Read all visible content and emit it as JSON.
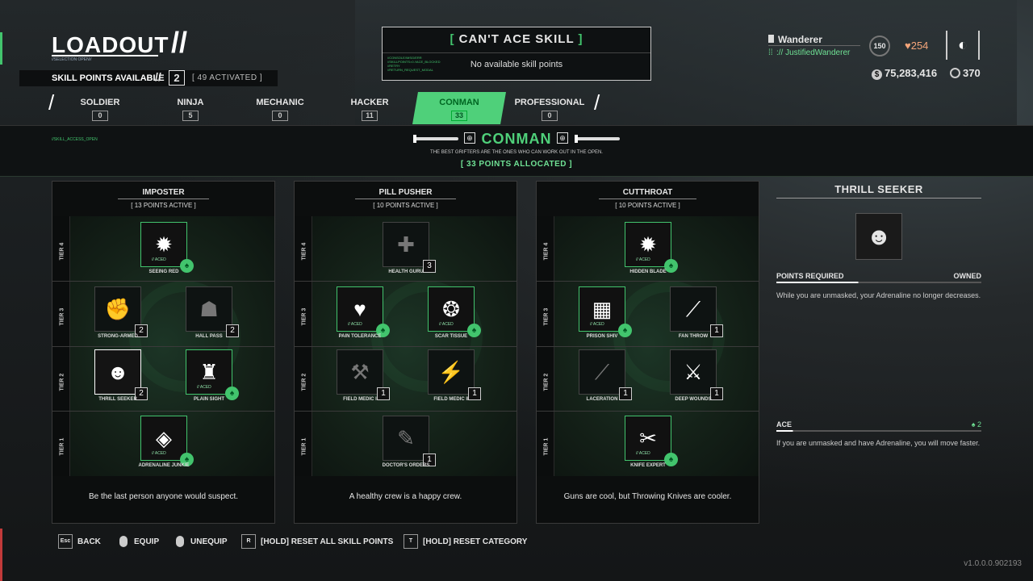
{
  "header": {
    "title": "LOADOUT",
    "sub_tag": "//SELECTION OPEN//",
    "skill_points_label": "SKILL POINTS AVAILABLE",
    "skill_points_value": "2",
    "activated_text": "[ 49 ACTIVATED ]"
  },
  "notice": {
    "title_open": "[",
    "title": "CAN'T ACE SKILL",
    "title_close": "]",
    "message": "No available skill points",
    "tiny": "//CONSOLE//MSG/ERR //SKILLPOINTS=0 //ACE_BLOCKED //RETRY //RETURN_REQUEST_MODAL"
  },
  "user": {
    "name": "Wanderer",
    "tag": ":// JustifiedWanderer",
    "level": "150",
    "hearts": "254",
    "cash": "75,283,416",
    "coins": "370"
  },
  "tabs": [
    {
      "label": "SOLDIER",
      "count": "0"
    },
    {
      "label": "NINJA",
      "count": "5"
    },
    {
      "label": "MECHANIC",
      "count": "0"
    },
    {
      "label": "HACKER",
      "count": "11"
    },
    {
      "label": "CONMAN",
      "count": "33"
    },
    {
      "label": "PROFESSIONAL",
      "count": "0"
    }
  ],
  "category": {
    "access": "//SKILL_ACCESS_OPEN",
    "name": "CONMAN",
    "desc": "THE BEST GRIFTERS ARE THE ONES WHO CAN WORK OUT IN THE OPEN.",
    "points": "[ 33 POINTS ALLOCATED ]"
  },
  "tiers": [
    "TIER 4",
    "TIER 3",
    "TIER 2",
    "TIER 1"
  ],
  "trees": [
    {
      "name": "IMPOSTER",
      "points": "[ 13 POINTS ACTIVE ]",
      "footer": "Be the last person anyone would suspect.",
      "skills": [
        {
          "label": "SEEING RED",
          "aced": "// ACED"
        },
        {
          "label": "STRONG-ARMED",
          "badge": "2"
        },
        {
          "label": "HALL PASS",
          "badge": "2"
        },
        {
          "label": "THRILL SEEKER",
          "badge": "2"
        },
        {
          "label": "PLAIN SIGHT",
          "aced": "// ACED"
        },
        {
          "label": "ADRENALINE JUNKIE",
          "aced": "// ACED"
        }
      ]
    },
    {
      "name": "PILL PUSHER",
      "points": "[ 10 POINTS ACTIVE ]",
      "footer": "A healthy crew is a happy crew.",
      "skills": [
        {
          "label": "HEALTH GURU",
          "badge": "3"
        },
        {
          "label": "PAIN TOLERANCE",
          "aced": "// ACED"
        },
        {
          "label": "SCAR TISSUE",
          "aced": "// ACED"
        },
        {
          "label": "FIELD MEDIC I",
          "badge": "1"
        },
        {
          "label": "FIELD MEDIC II",
          "badge": "1"
        },
        {
          "label": "DOCTOR'S ORDERS",
          "badge": "1"
        }
      ]
    },
    {
      "name": "CUTTHROAT",
      "points": "[ 10 POINTS ACTIVE ]",
      "footer": "Guns are cool, but Throwing Knives are cooler.",
      "skills": [
        {
          "label": "HIDDEN BLADE",
          "aced": "// ACED"
        },
        {
          "label": "PRISON SHIV",
          "aced": "// ACED"
        },
        {
          "label": "FAN THROW",
          "badge": "1"
        },
        {
          "label": "LACERATION",
          "badge": "1"
        },
        {
          "label": "DEEP WOUNDS",
          "badge": "1"
        },
        {
          "label": "KNIFE EXPERT",
          "aced": "// ACED"
        }
      ]
    }
  ],
  "detail": {
    "title": "THRILL SEEKER",
    "points_required": "POINTS REQUIRED",
    "owned": "OWNED",
    "base_desc": "While you are unmasked, your Adrenaline no longer decreases.",
    "ace_label": "ACE",
    "ace_cost": "2",
    "ace_desc": "If you are unmasked and have Adrenaline, you will move faster."
  },
  "footer": {
    "back_key": "Esc",
    "back": "BACK",
    "equip": "EQUIP",
    "unequip": "UNEQUIP",
    "reset_all_key": "R",
    "reset_all": "[HOLD] RESET ALL SKILL POINTS",
    "reset_cat_key": "T",
    "reset_cat": "[HOLD] RESET CATEGORY"
  },
  "version": "v1.0.0.0.902193"
}
